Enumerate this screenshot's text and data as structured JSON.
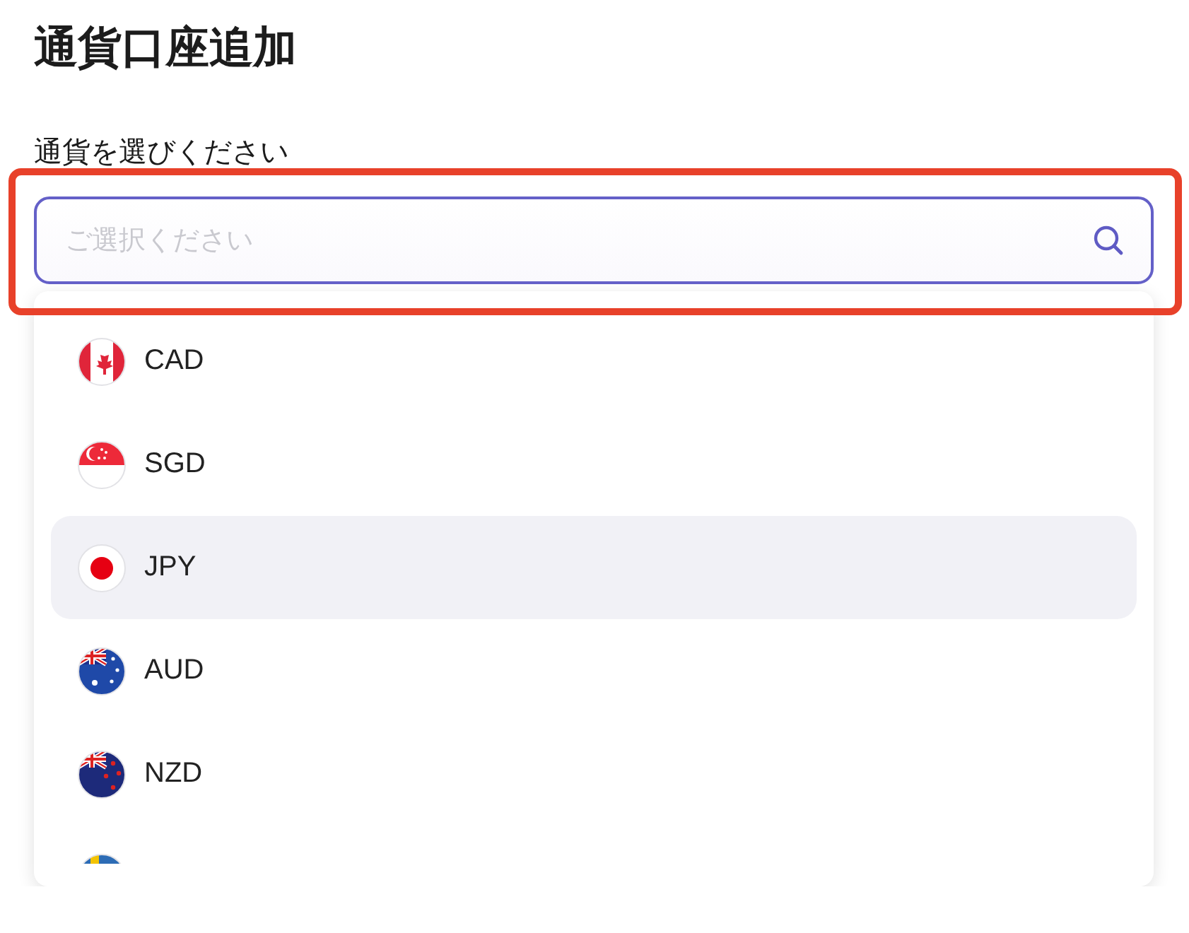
{
  "title": "通貨口座追加",
  "field_label": "通貨を選びください",
  "search": {
    "placeholder": "ご選択ください",
    "highlighted": true
  },
  "currencies": [
    {
      "kind": "ca",
      "code": "CAD",
      "selected": false
    },
    {
      "kind": "sg",
      "code": "SGD",
      "selected": false
    },
    {
      "kind": "jp",
      "code": "JPY",
      "selected": true
    },
    {
      "kind": "au",
      "code": "AUD",
      "selected": false
    },
    {
      "kind": "nz",
      "code": "NZD",
      "selected": false
    },
    {
      "kind": "se",
      "selected": false
    }
  ]
}
